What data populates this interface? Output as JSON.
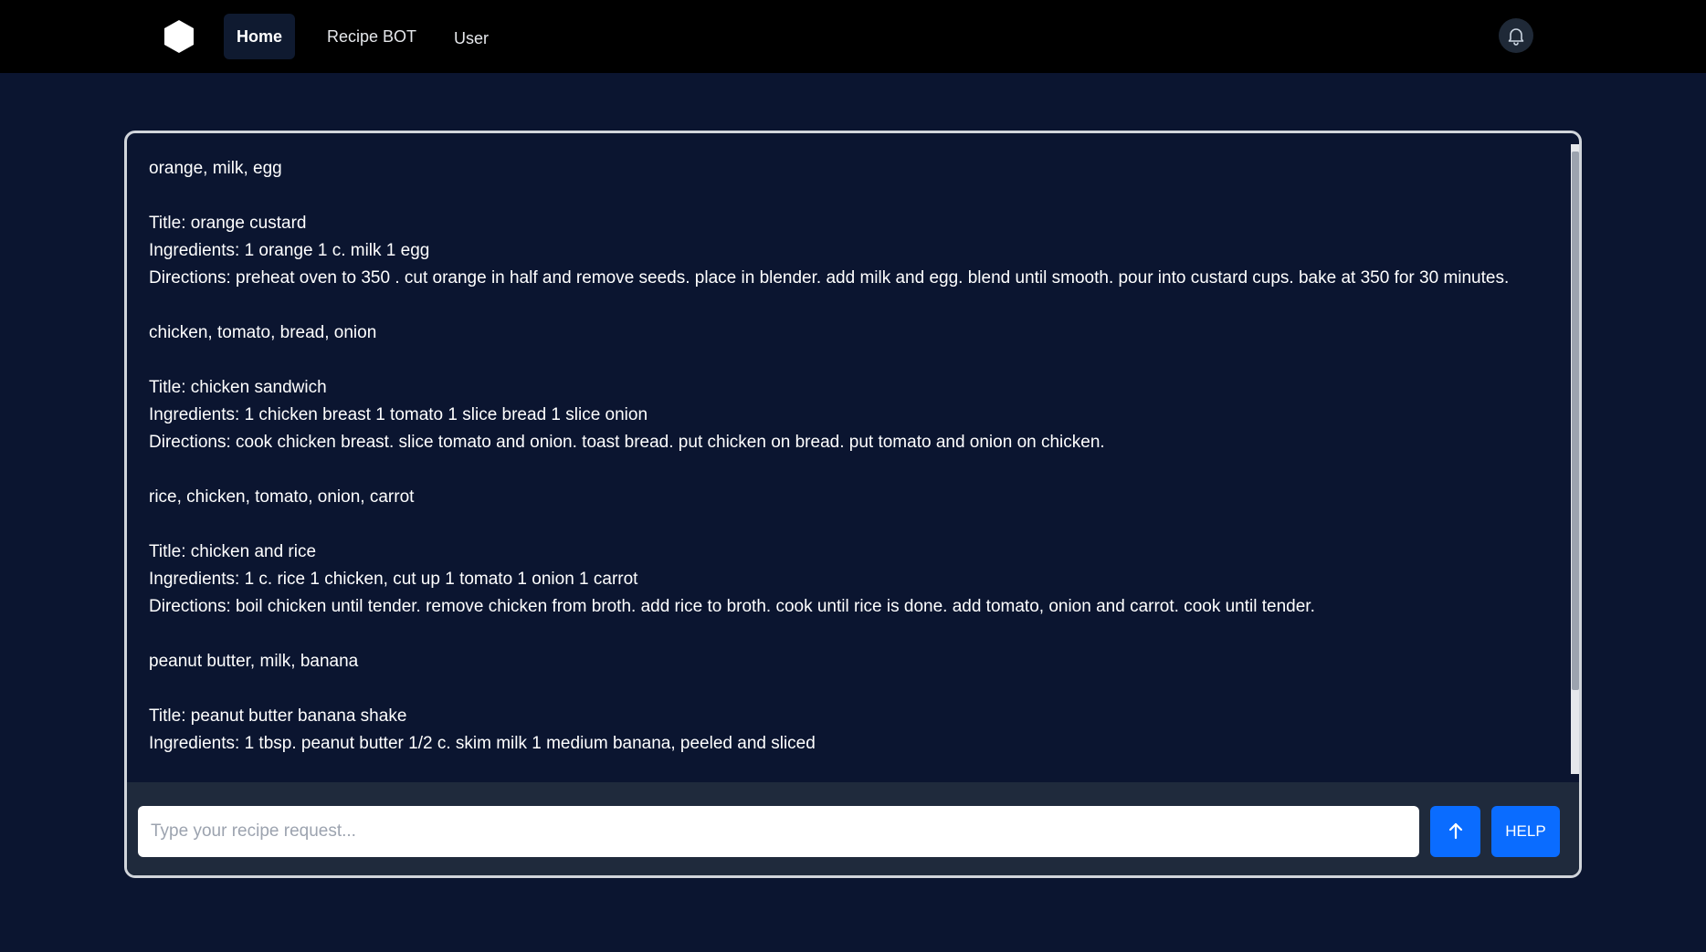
{
  "nav": {
    "logo_icon": "hexagon-logo-icon",
    "items": [
      {
        "label": "Home",
        "active": true
      },
      {
        "label": "Recipe BOT",
        "active": false
      },
      {
        "label": "User",
        "active": false
      }
    ],
    "bell_icon": "bell-icon"
  },
  "chat": {
    "lines": [
      "orange, milk, egg",
      "",
      "Title: orange custard",
      "Ingredients: 1 orange 1 c. milk 1 egg",
      "Directions: preheat oven to 350 . cut orange in half and remove seeds. place in blender. add milk and egg. blend until smooth. pour into custard cups. bake at 350 for 30 minutes.",
      "",
      "chicken, tomato, bread, onion",
      "",
      "Title: chicken sandwich",
      "Ingredients: 1 chicken breast 1 tomato 1 slice bread 1 slice onion",
      "Directions: cook chicken breast. slice tomato and onion. toast bread. put chicken on bread. put tomato and onion on chicken.",
      "",
      "rice, chicken, tomato, onion, carrot",
      "",
      "Title: chicken and rice",
      "Ingredients: 1 c. rice 1 chicken, cut up 1 tomato 1 onion 1 carrot",
      "Directions: boil chicken until tender. remove chicken from broth. add rice to broth. cook until rice is done. add tomato, onion and carrot. cook until tender.",
      "",
      "peanut butter, milk, banana",
      "",
      "Title: peanut butter banana shake",
      "Ingredients: 1 tbsp. peanut butter 1/2 c. skim milk 1 medium banana, peeled and sliced"
    ]
  },
  "input": {
    "placeholder": "Type your recipe request...",
    "value": ""
  },
  "buttons": {
    "send_icon": "arrow-up-icon",
    "help_label": "HELP"
  },
  "colors": {
    "page_bg": "#0b1530",
    "navbar_bg": "#000000",
    "accent": "#0a6cff",
    "input_area_bg": "#1f2a3c"
  }
}
